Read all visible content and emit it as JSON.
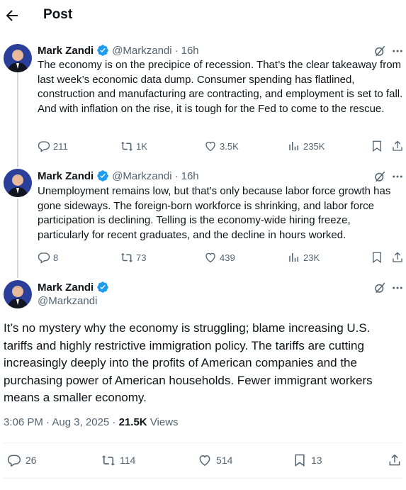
{
  "header": {
    "title": "Post",
    "back_icon": "arrow-left-icon"
  },
  "author": {
    "name": "Mark Zandi",
    "handle": "@Markzandi",
    "verified_color": "#1d9bf0"
  },
  "thread": [
    {
      "time": "16h",
      "text": "The economy is on the precipice of recession. That’s the clear takeaway from last week’s economic data dump. Consumer spending has flatlined, construction and manufacturing are contracting, and employment is set to fall. And with inflation on the rise, it is tough for the Fed to come to the rescue.",
      "replies": "211",
      "reposts": "1K",
      "likes": "3.5K",
      "views": "235K"
    },
    {
      "time": "16h",
      "text": "Unemployment remains low, but that’s only because labor force growth has gone sideways. The foreign-born workforce is shrinking, and labor force participation is declining. Telling is the economy-wide hiring freeze, particularly for recent graduates, and the decline in hours worked.",
      "replies": "8",
      "reposts": "73",
      "likes": "439",
      "views": "23K"
    }
  ],
  "main_post": {
    "text": "It’s no mystery why the economy is struggling; blame increasing U.S. tariffs and highly restrictive immigration policy. The tariffs are cutting increasingly deeply into the profits of American companies and the purchasing power of American households. Fewer immigrant workers means a smaller economy.",
    "timestamp": "3:06 PM · Aug 3, 2025 · ",
    "views_count": "21.5K",
    "views_label": "Views",
    "replies": "26",
    "reposts": "114",
    "likes": "514",
    "bookmarks": "13"
  },
  "separator": "·"
}
